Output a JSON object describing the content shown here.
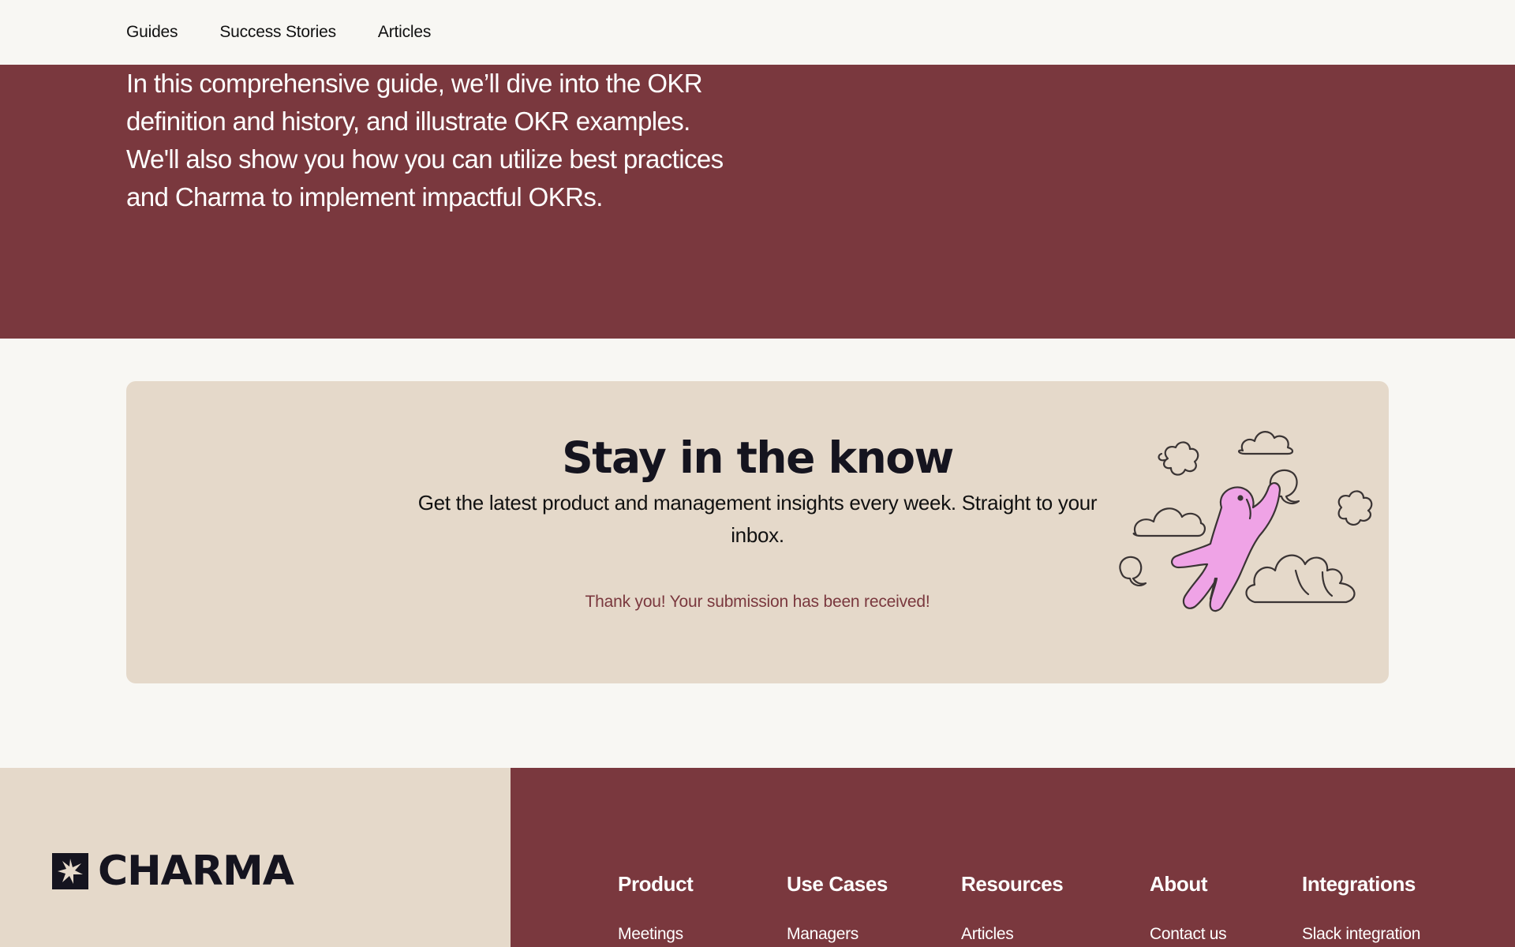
{
  "nav": {
    "items": [
      {
        "label": "Guides"
      },
      {
        "label": "Success Stories"
      },
      {
        "label": "Articles"
      }
    ]
  },
  "hero": {
    "text": "In this comprehensive guide, we’ll dive into the OKR definition and history, and illustrate OKR examples. We'll also show you how you can utilize best practices and Charma to implement impactful OKRs."
  },
  "newsletter": {
    "title": "Stay in the know",
    "subtitle": "Get the latest product and management insights every week. Straight to your inbox.",
    "success_message": "Thank you! Your submission has been received!",
    "illustration_icon": "floating-figure-with-clouds-illustration"
  },
  "footer": {
    "logo": {
      "wordmark": "CHARMA",
      "icon": "asterisk-star-icon"
    },
    "columns": [
      {
        "heading": "Product",
        "first_link": "Meetings"
      },
      {
        "heading": "Use Cases",
        "first_link": "Managers"
      },
      {
        "heading": "Resources",
        "first_link": "Articles"
      },
      {
        "heading": "About",
        "first_link": "Contact us"
      },
      {
        "heading": "Integrations",
        "first_link": "Slack integration"
      }
    ]
  },
  "colors": {
    "maroon": "#7A383E",
    "beige": "#E5D9CA",
    "off_white": "#F8F7F3",
    "ink": "#15141F",
    "pink": "#EFA3E6"
  }
}
